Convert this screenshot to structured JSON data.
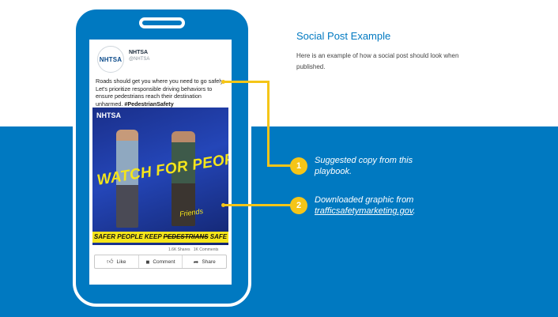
{
  "title": "Social Post Example",
  "description": "Here is an example of how a social post should look when published.",
  "post": {
    "account_name": "NHTSA",
    "account_handle": "@NHTSA",
    "avatar_logo": "NHTSA",
    "copy": "Roads should get you where you need to go safely. Let's prioritize responsible driving behaviors to ensure pedestrians reach their destination unharmed.",
    "hashtag": "#PedestrianSafety",
    "graphic": {
      "logo": "NHTSA",
      "headline": "WATCH FOR PEOPLE",
      "signature": "Friends",
      "tagline_prefix": "SAFER PEOPLE KEEP ",
      "tagline_struck": "PEDESTRIANS",
      "tagline_suffix": " SAFE"
    },
    "shares": "1.6K Shares",
    "comments": "1K Comments",
    "actions": [
      {
        "label": "Like",
        "icon": "thumbs-up-icon"
      },
      {
        "label": "Comment",
        "icon": "comment-icon"
      },
      {
        "label": "Share",
        "icon": "share-icon"
      }
    ]
  },
  "callouts": [
    {
      "number": "1",
      "text": "Suggested copy from this playbook."
    },
    {
      "number": "2",
      "text": "Downloaded graphic from ",
      "link": "trafficsafetymarketing.gov",
      "suffix": "."
    }
  ],
  "colors": {
    "brand_blue": "#0079c1",
    "accent_yellow": "#f5c518"
  }
}
